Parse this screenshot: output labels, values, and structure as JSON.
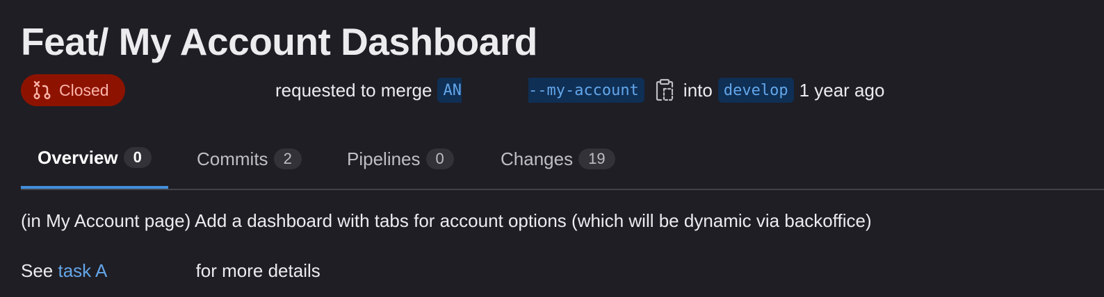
{
  "title": "Feat/ My Account Dashboard",
  "status": {
    "label": "Closed",
    "icon": "merge-request-close-icon",
    "color": "#8d1300"
  },
  "merge_info": {
    "requested_text": "requested to merge",
    "source_branch_start": "AN",
    "source_branch_end": "--my-account",
    "into_text": "into",
    "target_branch": "develop",
    "time_ago": "1 year ago",
    "copy_icon": "copy-to-clipboard-icon"
  },
  "tabs": [
    {
      "label": "Overview",
      "count": "0",
      "active": true
    },
    {
      "label": "Commits",
      "count": "2",
      "active": false
    },
    {
      "label": "Pipelines",
      "count": "0",
      "active": false
    },
    {
      "label": "Changes",
      "count": "19",
      "active": false
    }
  ],
  "description": "(in My Account page) Add a dashboard with tabs for account options (which will be dynamic via backoffice)",
  "details": {
    "prefix": "See",
    "link_text": "task A",
    "suffix": "for more details"
  },
  "colors": {
    "background": "#1f1e24",
    "text": "#ececef",
    "link": "#63a6e9",
    "active_tab_underline": "#428fdc"
  }
}
